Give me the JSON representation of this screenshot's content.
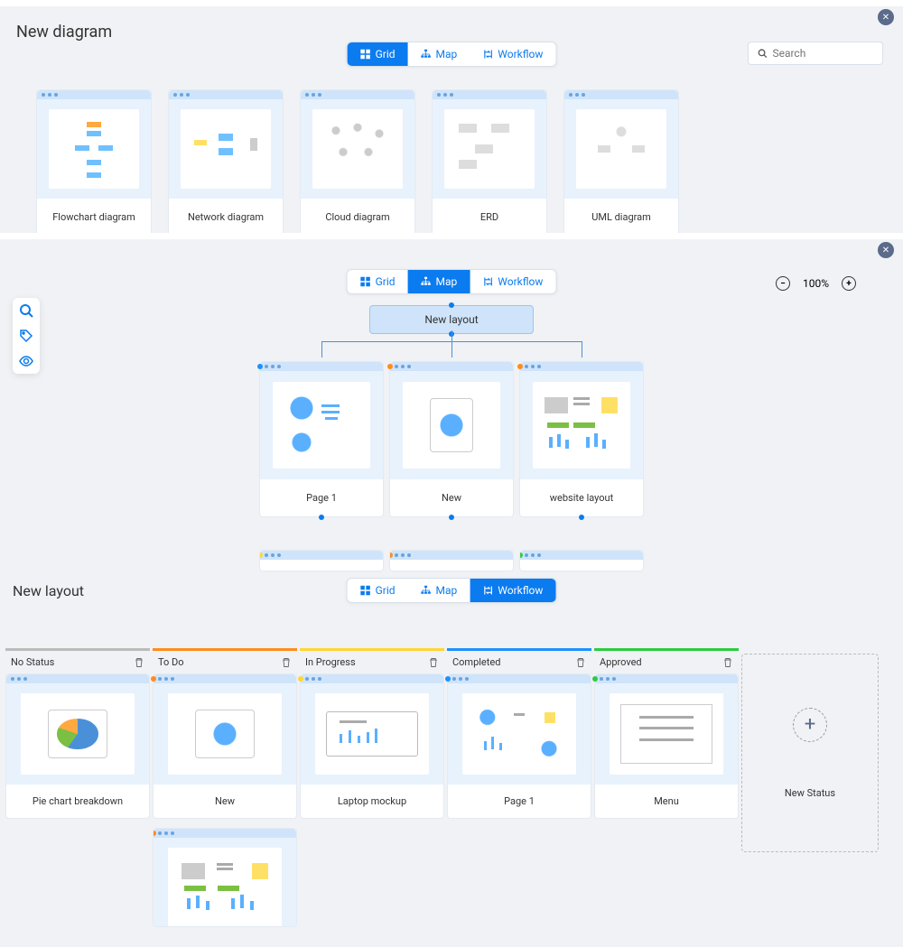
{
  "tabs": {
    "grid": "Grid",
    "map": "Map",
    "workflow": "Workflow"
  },
  "section1": {
    "title": "New diagram",
    "search_placeholder": "Search",
    "templates": [
      {
        "label": "Flowchart diagram"
      },
      {
        "label": "Network diagram"
      },
      {
        "label": "Cloud diagram"
      },
      {
        "label": "ERD"
      },
      {
        "label": "UML diagram"
      }
    ]
  },
  "section2": {
    "zoom": "100%",
    "root_label": "New layout",
    "children": [
      {
        "label": "Page 1"
      },
      {
        "label": "New"
      },
      {
        "label": "website layout"
      }
    ]
  },
  "section3": {
    "title": "New layout",
    "columns": [
      {
        "name": "No Status",
        "color": "#bbb",
        "cards": [
          {
            "label": "Pie chart breakdown"
          }
        ]
      },
      {
        "name": "To Do",
        "color": "#ff8c1a",
        "cards": [
          {
            "label": "New"
          }
        ]
      },
      {
        "name": "In Progress",
        "color": "#ffd633",
        "cards": [
          {
            "label": "Laptop mockup"
          }
        ]
      },
      {
        "name": "Completed",
        "color": "#1e90ff",
        "cards": [
          {
            "label": "Page 1"
          }
        ]
      },
      {
        "name": "Approved",
        "color": "#2ecc40",
        "cards": [
          {
            "label": "Menu"
          }
        ]
      }
    ],
    "new_status": "New Status"
  }
}
